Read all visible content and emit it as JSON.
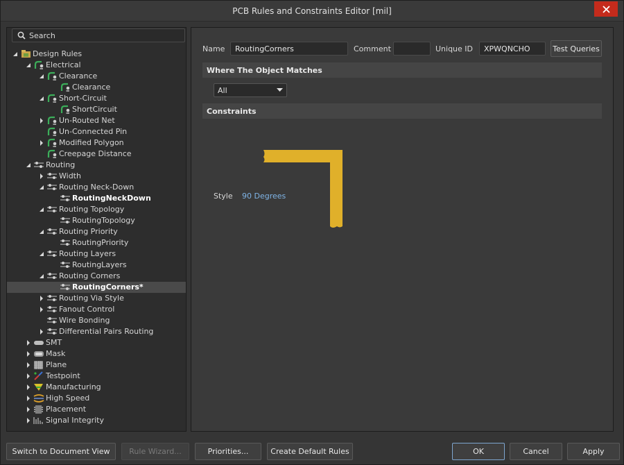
{
  "window": {
    "title": "PCB Rules and Constraints Editor [mil]",
    "close_glyph": "✕"
  },
  "search": {
    "label": "Search"
  },
  "tree": [
    {
      "label": "Design Rules",
      "level": 0,
      "arrow": "down",
      "icon": "design-rules-icon",
      "bold": false
    },
    {
      "label": "Electrical",
      "level": 1,
      "arrow": "down",
      "icon": "electrical-rule-icon"
    },
    {
      "label": "Clearance",
      "level": 2,
      "arrow": "down",
      "icon": "electrical-rule-icon"
    },
    {
      "label": "Clearance",
      "level": 3,
      "arrow": "none",
      "icon": "electrical-rule-icon"
    },
    {
      "label": "Short-Circuit",
      "level": 2,
      "arrow": "down",
      "icon": "electrical-rule-icon"
    },
    {
      "label": "ShortCircuit",
      "level": 3,
      "arrow": "none",
      "icon": "electrical-rule-icon"
    },
    {
      "label": "Un-Routed Net",
      "level": 2,
      "arrow": "right",
      "icon": "electrical-rule-icon"
    },
    {
      "label": "Un-Connected Pin",
      "level": 2,
      "arrow": "none",
      "icon": "electrical-rule-icon"
    },
    {
      "label": "Modified Polygon",
      "level": 2,
      "arrow": "right",
      "icon": "electrical-rule-icon"
    },
    {
      "label": "Creepage Distance",
      "level": 2,
      "arrow": "none",
      "icon": "electrical-rule-icon"
    },
    {
      "label": "Routing",
      "level": 1,
      "arrow": "down",
      "icon": "routing-rule-icon"
    },
    {
      "label": "Width",
      "level": 2,
      "arrow": "right",
      "icon": "routing-rule-icon"
    },
    {
      "label": "Routing Neck-Down",
      "level": 2,
      "arrow": "down",
      "icon": "routing-rule-icon"
    },
    {
      "label": "RoutingNeckDown",
      "level": 3,
      "arrow": "none",
      "icon": "routing-rule-icon",
      "bold": true
    },
    {
      "label": "Routing Topology",
      "level": 2,
      "arrow": "down",
      "icon": "routing-rule-icon"
    },
    {
      "label": "RoutingTopology",
      "level": 3,
      "arrow": "none",
      "icon": "routing-rule-icon"
    },
    {
      "label": "Routing Priority",
      "level": 2,
      "arrow": "down",
      "icon": "routing-rule-icon"
    },
    {
      "label": "RoutingPriority",
      "level": 3,
      "arrow": "none",
      "icon": "routing-rule-icon"
    },
    {
      "label": "Routing Layers",
      "level": 2,
      "arrow": "down",
      "icon": "routing-rule-icon"
    },
    {
      "label": "RoutingLayers",
      "level": 3,
      "arrow": "none",
      "icon": "routing-rule-icon"
    },
    {
      "label": "Routing Corners",
      "level": 2,
      "arrow": "down",
      "icon": "routing-rule-icon"
    },
    {
      "label": "RoutingCorners*",
      "level": 3,
      "arrow": "none",
      "icon": "routing-rule-icon",
      "bold": true,
      "selected": true
    },
    {
      "label": "Routing Via Style",
      "level": 2,
      "arrow": "right",
      "icon": "routing-rule-icon"
    },
    {
      "label": "Fanout Control",
      "level": 2,
      "arrow": "right",
      "icon": "routing-rule-icon"
    },
    {
      "label": "Wire Bonding",
      "level": 2,
      "arrow": "none",
      "icon": "routing-rule-icon"
    },
    {
      "label": "Differential Pairs Routing",
      "level": 2,
      "arrow": "right",
      "icon": "routing-rule-icon"
    },
    {
      "label": "SMT",
      "level": 1,
      "arrow": "right",
      "icon": "smt-icon"
    },
    {
      "label": "Mask",
      "level": 1,
      "arrow": "right",
      "icon": "mask-icon"
    },
    {
      "label": "Plane",
      "level": 1,
      "arrow": "right",
      "icon": "plane-icon"
    },
    {
      "label": "Testpoint",
      "level": 1,
      "arrow": "right",
      "icon": "testpoint-icon"
    },
    {
      "label": "Manufacturing",
      "level": 1,
      "arrow": "right",
      "icon": "manufacturing-icon"
    },
    {
      "label": "High Speed",
      "level": 1,
      "arrow": "right",
      "icon": "high-speed-icon"
    },
    {
      "label": "Placement",
      "level": 1,
      "arrow": "right",
      "icon": "placement-icon"
    },
    {
      "label": "Signal Integrity",
      "level": 1,
      "arrow": "right",
      "icon": "signal-integrity-icon"
    }
  ],
  "rule": {
    "name_label": "Name",
    "name_value": "RoutingCorners",
    "comment_label": "Comment",
    "comment_value": "",
    "unique_id_label": "Unique ID",
    "unique_id_value": "XPWQNCHO",
    "test_queries_label": "Test Queries"
  },
  "where_matches": {
    "title": "Where The Object Matches",
    "selected": "All"
  },
  "constraints": {
    "title": "Constraints",
    "style_label": "Style",
    "style_value": "90 Degrees"
  },
  "buttons": {
    "switch_view": "Switch to Document View",
    "rule_wizard": "Rule Wizard...",
    "priorities": "Priorities...",
    "create_default": "Create Default Rules",
    "ok": "OK",
    "cancel": "Cancel",
    "apply": "Apply"
  },
  "colors": {
    "track": "#e0b02a",
    "link": "#7fb4e6",
    "close": "#c42b1c"
  }
}
